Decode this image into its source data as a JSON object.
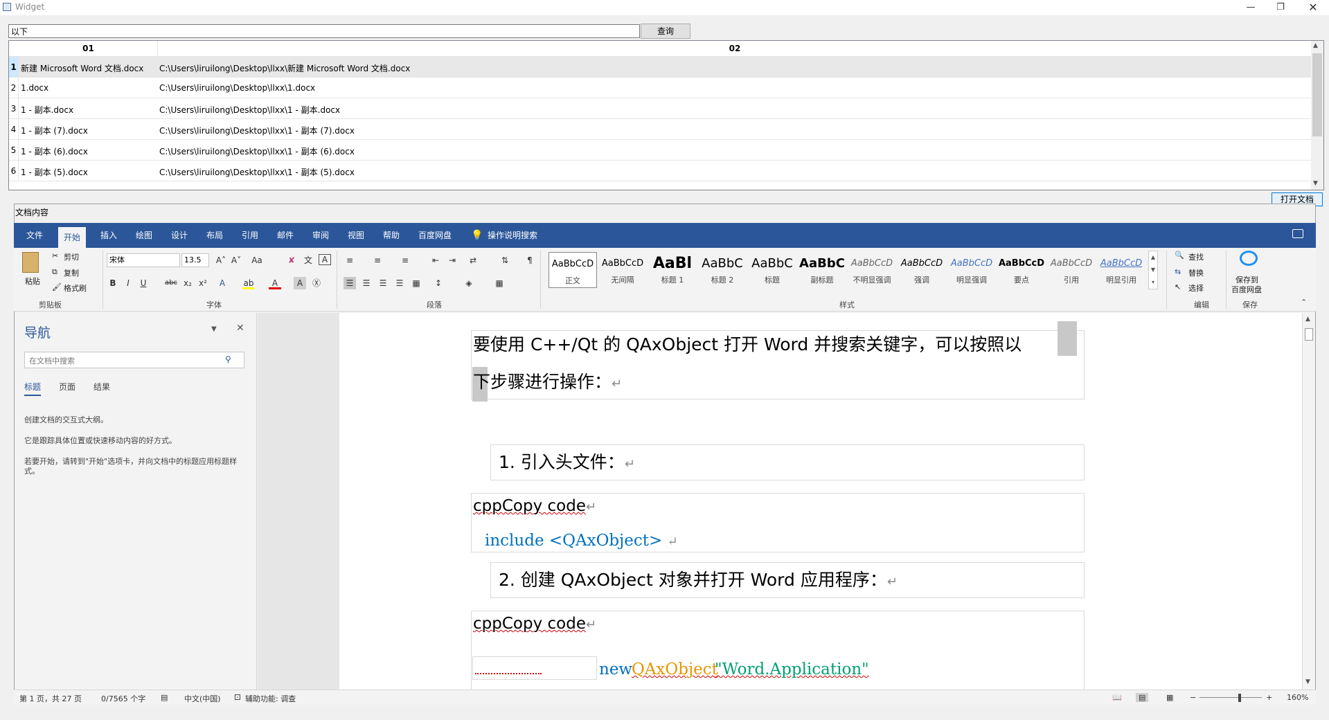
{
  "window": {
    "title": "Widget"
  },
  "search": {
    "value": "以下",
    "query_label": "查询"
  },
  "table": {
    "headers": [
      "01",
      "02"
    ],
    "rows": [
      {
        "n": "1",
        "name": "新建 Microsoft Word 文档.docx",
        "path": "C:\\Users\\liruilong\\Desktop\\llxx\\新建 Microsoft Word 文档.docx"
      },
      {
        "n": "2",
        "name": "1.docx",
        "path": "C:\\Users\\liruilong\\Desktop\\llxx\\1.docx"
      },
      {
        "n": "3",
        "name": "1 - 副本.docx",
        "path": "C:\\Users\\liruilong\\Desktop\\llxx\\1 - 副本.docx"
      },
      {
        "n": "4",
        "name": "1 - 副本 (7).docx",
        "path": "C:\\Users\\liruilong\\Desktop\\llxx\\1 - 副本 (7).docx"
      },
      {
        "n": "5",
        "name": "1 - 副本 (6).docx",
        "path": "C:\\Users\\liruilong\\Desktop\\llxx\\1 - 副本 (6).docx"
      },
      {
        "n": "6",
        "name": "1 - 副本 (5).docx",
        "path": "C:\\Users\\liruilong\\Desktop\\llxx\\1 - 副本 (5).docx"
      }
    ]
  },
  "open_button": "打开文档",
  "doc_group_label": "文档内容",
  "ribbon": {
    "tabs": [
      "文件",
      "开始",
      "插入",
      "绘图",
      "设计",
      "布局",
      "引用",
      "邮件",
      "审阅",
      "视图",
      "帮助",
      "百度网盘"
    ],
    "tell_me": "操作说明搜索",
    "clipboard": {
      "paste": "粘贴",
      "cut": "剪切",
      "copy": "复制",
      "format_painter": "格式刷",
      "label": "剪贴板"
    },
    "font": {
      "name": "宋体",
      "size": "13.5",
      "label": "字体"
    },
    "paragraph": {
      "label": "段落"
    },
    "styles": {
      "label": "样式",
      "items": [
        {
          "preview": "AaBbCcD",
          "name": "正文"
        },
        {
          "preview": "AaBbCcD",
          "name": "无间隔"
        },
        {
          "preview": "AaBl",
          "name": "标题 1"
        },
        {
          "preview": "AaBbC",
          "name": "标题 2"
        },
        {
          "preview": "AaBbC",
          "name": "标题"
        },
        {
          "preview": "AaBbC",
          "name": "副标题"
        },
        {
          "preview": "AaBbCcD",
          "name": "不明显强调"
        },
        {
          "preview": "AaBbCcD",
          "name": "强调"
        },
        {
          "preview": "AaBbCcD",
          "name": "明显强调"
        },
        {
          "preview": "AaBbCcD",
          "name": "要点"
        },
        {
          "preview": "AaBbCcD",
          "name": "引用"
        },
        {
          "preview": "AaBbCcD",
          "name": "明显引用"
        }
      ]
    },
    "editing": {
      "find": "查找",
      "replace": "替换",
      "select": "选择",
      "label": "编辑"
    },
    "save": {
      "line1": "保存到",
      "line2": "百度网盘",
      "label": "保存"
    }
  },
  "nav": {
    "title": "导航",
    "search_placeholder": "在文档中搜索",
    "tabs": [
      "标题",
      "页面",
      "结果"
    ],
    "text1": "创建文档的交互式大纲。",
    "text2": "它是跟踪具体位置或快速移动内容的好方式。",
    "text3": "若要开始，请转到\"开始\"选项卡，并向文档中的标题应用标题样式。"
  },
  "document": {
    "p1a": "要使用 C++/Qt 的 QAxObject 打开 Word 并搜索关键字，可以按照",
    "p1hl": "以",
    "p1b_hl": "下",
    "p1b": "步骤进行操作：",
    "item1": "1.  引入头文件：",
    "code1_title": "cppCopy code",
    "code1_body": "include <QAxObject>",
    "item2": "2.  创建 QAxObject 对象并打开 Word 应用程序：",
    "code2_title": "cppCopy code",
    "code2_new": "new",
    "code2_class": "QAxObject",
    "code2_str": "\"Word.Application\""
  },
  "status": {
    "page": "第 1 页，共 27 页",
    "words": "0/7565 个字",
    "lang": "中文(中国)",
    "access": "辅助功能: 调查",
    "zoom": "160%"
  },
  "colors": {
    "ribbon": "#2b579a",
    "keyword": "#0070c0",
    "string": "#00a070",
    "class": "#e69500"
  }
}
